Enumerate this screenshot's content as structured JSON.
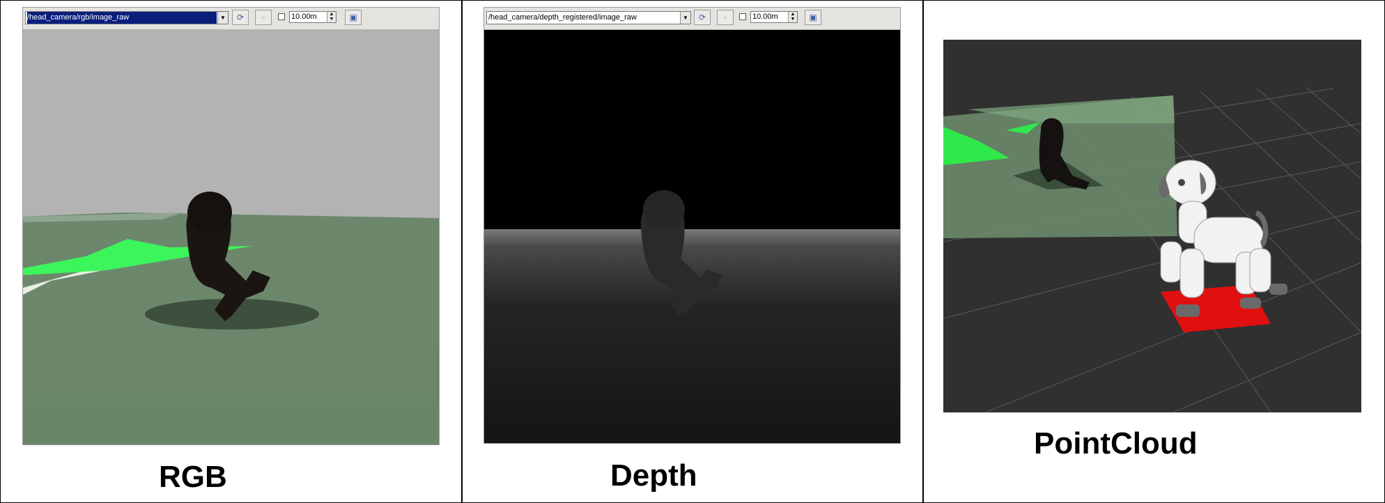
{
  "panels": [
    {
      "caption": "RGB",
      "topic": "/head_camera/rgb/image_raw",
      "range": "10.00m"
    },
    {
      "caption": "Depth",
      "topic": "/head_camera/depth_registered/image_raw",
      "range": "10.00m"
    },
    {
      "caption": "PointCloud"
    }
  ],
  "colors": {
    "sky_gray": "#b3b3b3",
    "ground_green": "#6e8a6e",
    "laser_green": "#33ff55",
    "rviz_background": "#303030",
    "robot_footprint": "#e01010"
  },
  "icons": [
    "refresh-icon",
    "save-icon",
    "zoom-fit-icon",
    "dropdown-arrow-icon"
  ]
}
